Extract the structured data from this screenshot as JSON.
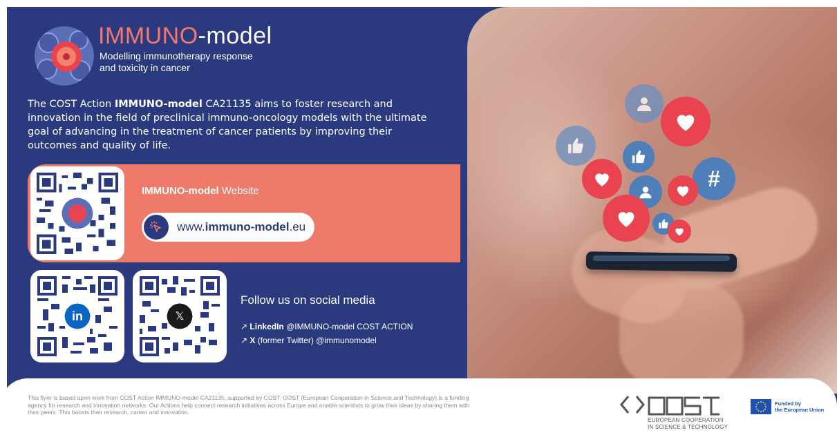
{
  "header": {
    "title_part1": "IMMUNO",
    "title_part2": "-model",
    "subtitle_line1": "Modelling immunotherapy response",
    "subtitle_line2": "and toxicity in cancer"
  },
  "intro": {
    "before": "The COST Action ",
    "bold": "IMMUNO-model",
    "after": " CA21135 aims to foster research and innovation in the field of preclinical immuno-oncology models with the ultimate goal of advancing in the treatment of cancer patients by improving their outcomes and quality of life."
  },
  "website": {
    "label_bold": "IMMUNO-model",
    "label_rest": " Website",
    "url_prefix": "www.",
    "url_bold": "immuno-model",
    "url_suffix": ".eu"
  },
  "social": {
    "title": "Follow us on social media",
    "linkedin_label": "LinkedIn",
    "linkedin_handle": " @IMMUNO-model COST ACTION",
    "x_label": "X",
    "x_handle": " (former Twitter) @immunomodel",
    "arrow": "↗"
  },
  "qr_icons": {
    "linkedin": "in",
    "x": "𝕏"
  },
  "footer": {
    "disclaimer": "This flyer is based upon work from COST Action IMMUNO-model CA21135, supported by COST. COST (European Cooperation in Science and Technology) is a funding agency for research and innovation networks. Our Actions help connect research initiatives across Europe and enable scientists to grow their ideas by sharing them with their peers. This boosts their research, career and innovation.",
    "cost_line1": "EUROPEAN COOPERATION",
    "cost_line2": "IN SCIENCE & TECHNOLOGY",
    "eu_line1": "Funded by",
    "eu_line2": "the European Union"
  },
  "colors": {
    "navy": "#2b3a7e",
    "coral": "#f07a6a",
    "eu_blue": "#1e4fb5"
  },
  "icons": [
    "immuno-model-logo-icon",
    "link-click-icon",
    "linkedin-icon",
    "x-icon",
    "cost-logo-icon",
    "eu-flag-icon",
    "heart-icon",
    "like-icon",
    "user-icon",
    "hashtag-icon"
  ]
}
